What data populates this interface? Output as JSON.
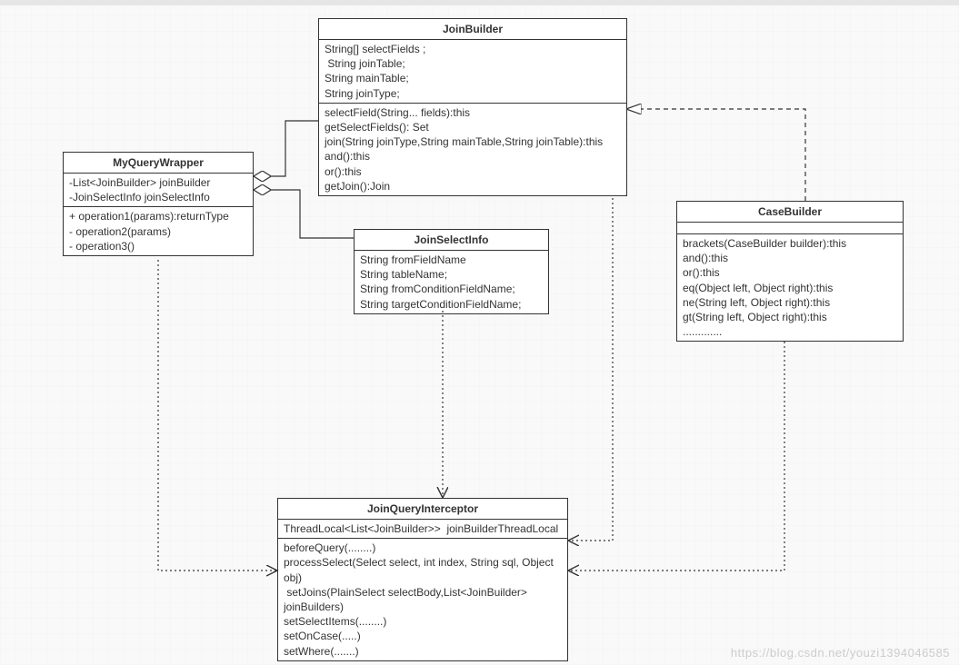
{
  "boxes": {
    "joinBuilder": {
      "title": "JoinBuilder",
      "attrs": "String[] selectFields ;\n String joinTable;\nString mainTable;\nString joinType;",
      "ops": "selectField(String... fields):this\ngetSelectFields(): Set\njoin(String joinType,String mainTable,String joinTable):this\nand():this\nor():this\ngetJoin():Join"
    },
    "myQueryWrapper": {
      "title": "MyQueryWrapper",
      "attrs": "-List<JoinBuilder> joinBuilder\n-JoinSelectInfo joinSelectInfo",
      "ops": "+ operation1(params):returnType\n- operation2(params)\n- operation3()"
    },
    "joinSelectInfo": {
      "title": "JoinSelectInfo",
      "attrs": "String fromFieldName\nString tableName;\nString fromConditionFieldName;\nString targetConditionFieldName;"
    },
    "caseBuilder": {
      "title": "CaseBuilder",
      "empty": "",
      "ops": "brackets(CaseBuilder builder):this\nand():this\nor():this\neq(Object left, Object right):this\nne(String left, Object right):this\ngt(String left, Object right):this\n............."
    },
    "joinQueryInterceptor": {
      "title": "JoinQueryInterceptor",
      "attrs": "ThreadLocal<List<JoinBuilder>>  joinBuilderThreadLocal",
      "ops": "beforeQuery(........)\nprocessSelect(Select select, int index, String sql, Object\nobj)\n setJoins(PlainSelect selectBody,List<JoinBuilder>\njoinBuilders)\nsetSelectItems(........)\nsetOnCase(.....)\nsetWhere(.......)"
    }
  },
  "watermark": "https://blog.csdn.net/youzi1394046585"
}
